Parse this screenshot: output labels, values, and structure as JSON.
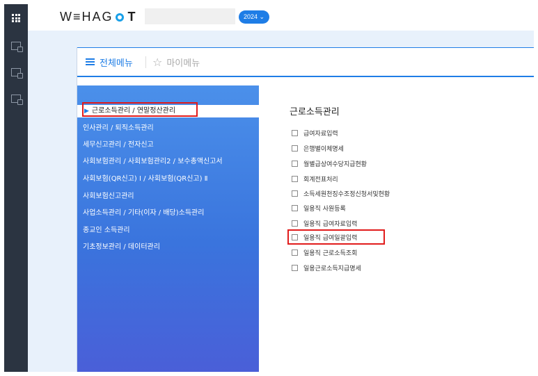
{
  "header": {
    "logo_prefix": "W≡HAG",
    "logo_suffix": "T",
    "year": "2024 ⌄"
  },
  "rail": {
    "icons": [
      "apps-grid-icon",
      "person-doc-icon",
      "tax-doc-icon",
      "settings-doc-icon"
    ]
  },
  "menu": {
    "tab_all": "전체메뉴",
    "tab_mine": "마이메뉴",
    "categories": [
      "근로소득관리 / 연말정산관리",
      "인사관리 / 퇴직소득관리",
      "세무신고관리 / 전자신고",
      "사회보험관리 / 사회보험관리2 / 보수총액신고서",
      "사회보험(QR신고) Ⅰ / 사회보험(QR신고) Ⅱ",
      "사회보험신고관리",
      "사업소득관리 / 기타(이자 / 배당)소득관리",
      "종교인 소득관리",
      "기초정보관리 / 데이터관리"
    ],
    "sub_title": "근로소득관리",
    "sub_items": [
      "급여자료입력",
      "은행별이체명세",
      "월별급상여수당지급현황",
      "회계전표처리",
      "소득세원천징수조정신청서및현황",
      "일용직 사원등록",
      "일용직 급여자료입력",
      "일용직 급여일괄입력",
      "일용직 근로소득조회",
      "일용근로소득지급명세"
    ]
  },
  "colors": {
    "accent": "#1e7de6",
    "rail": "#2b3441",
    "highlight": "#e11b1b"
  }
}
